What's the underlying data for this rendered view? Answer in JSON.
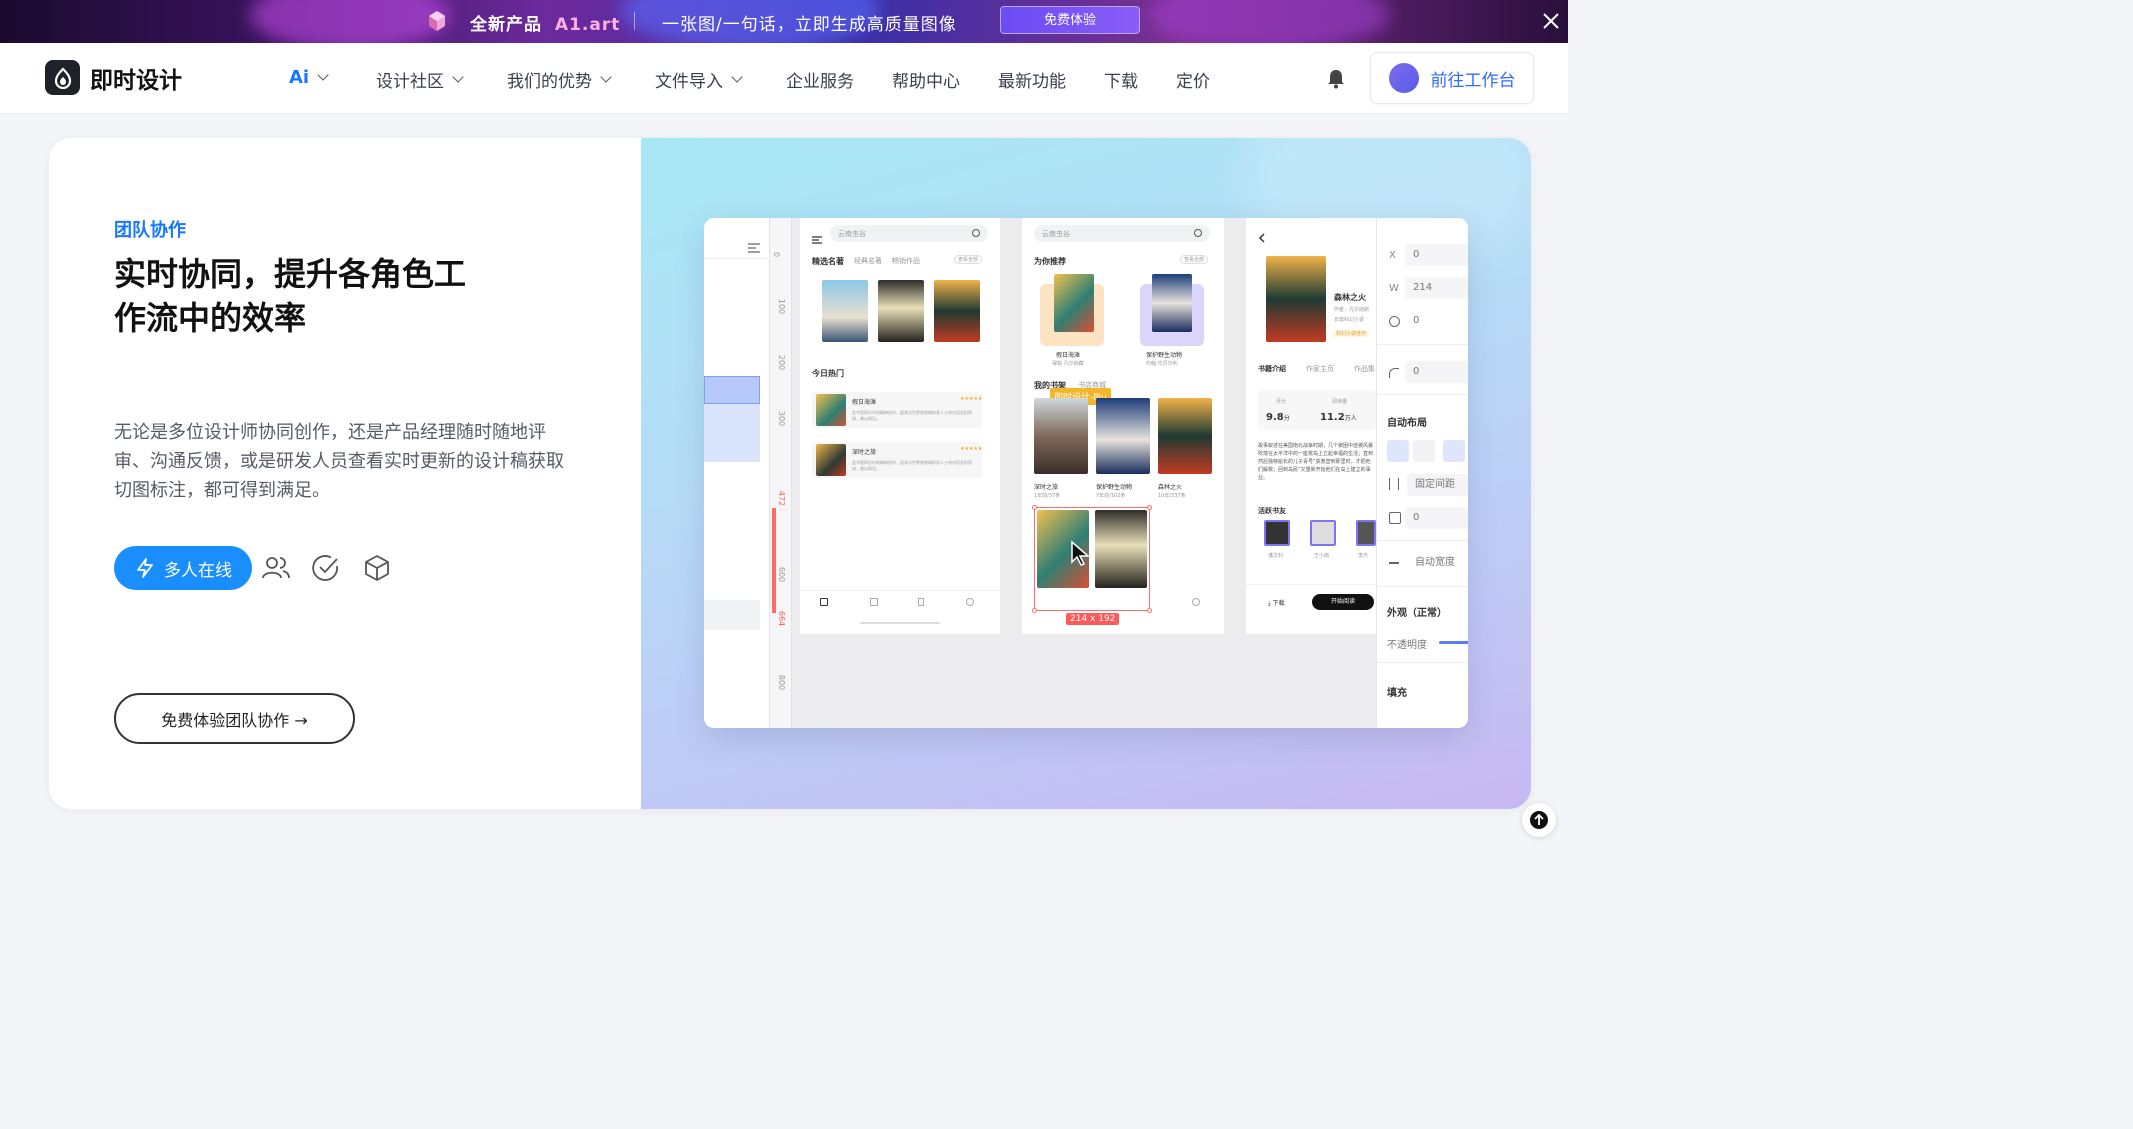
{
  "banner": {
    "product_prefix": "全新产品",
    "product_name": "A1.art",
    "tagline": "一张图/一句话，立即生成高质量图像",
    "cta": "免费体验"
  },
  "nav": {
    "brand": "即时设计",
    "items": [
      {
        "label": "Ai",
        "has_dropdown": true
      },
      {
        "label": "设计社区",
        "has_dropdown": true
      },
      {
        "label": "我们的优势",
        "has_dropdown": true
      },
      {
        "label": "文件导入",
        "has_dropdown": true
      },
      {
        "label": "企业服务",
        "has_dropdown": false
      },
      {
        "label": "帮助中心",
        "has_dropdown": false
      },
      {
        "label": "最新功能",
        "has_dropdown": false
      },
      {
        "label": "下载",
        "has_dropdown": false
      },
      {
        "label": "定价",
        "has_dropdown": false
      }
    ],
    "workspace_button": "前往工作台"
  },
  "hero": {
    "eyebrow": "团队协作",
    "headline_line1": "实时协同，提升各角色工",
    "headline_line2": "作流中的效率",
    "description": "无论是多位设计师协同创作，还是产品经理随时随地评审、沟通反馈，或是研发人员查看实时更新的设计稿获取切图标注，都可得到满足。",
    "active_feature": "多人在线",
    "feature_icons": [
      "users-icon",
      "check-circle-icon",
      "cube-icon"
    ],
    "cta": "免费体验团队协作 →"
  },
  "editor": {
    "ruler_marks": [
      "0",
      "100",
      "200",
      "300",
      "472",
      "600",
      "664",
      "800"
    ],
    "screen1": {
      "search": "云南虫谷",
      "tabs": [
        "精选名著",
        "经典名著",
        "畅销作品"
      ],
      "more": "查看全部",
      "section": "今日热门",
      "list": [
        {
          "title": "假日海滩",
          "stars": "★★★★★",
          "desc": "此书是四分尔的精神创作，虽其与世界各地域的发人士的对话交织而成，难以再见。"
        },
        {
          "title": "深时之旅",
          "stars": "★★★★★",
          "desc": "此书是四分尔的精神创作，虽其与世界各地域的发人士的对话交织而成，难以再见。"
        }
      ]
    },
    "screen2": {
      "search": "云南虫谷",
      "section": "为你推荐",
      "more": "查看全部",
      "recommend": [
        {
          "title": "假日海滩",
          "author": "得勒·凡尔纳藏"
        },
        {
          "title": "保护野生动物",
          "author": "约翰·坎贝尔利"
        }
      ],
      "tabs": [
        "我的书架",
        "书店商城"
      ],
      "collab_tag": "即时设计-Piu",
      "shelf": [
        {
          "title": "深时之旅",
          "meta": "1年前/37条"
        },
        {
          "title": "保护野生动物",
          "meta": "7年前/102条"
        },
        {
          "title": "森林之火",
          "meta": "10年/337条"
        }
      ],
      "selection_size": "214 x 192"
    },
    "screen3": {
      "book_title": "森林之火",
      "author": "作者：凡尔纳斯",
      "subtitle": "长篇科幻小说",
      "badge": "科幻小说佳作",
      "tabs": [
        "书籍介绍",
        "作家主页",
        "作品集"
      ],
      "rating_label": "评分",
      "rating": "9.8",
      "rating_unit": "分",
      "reads_label": "阅读量",
      "reads": "11.2",
      "reads_unit": "万人",
      "intro": "故事叙述在美国南北战争时期，几个被困中途被风暴吹落在太平洋中的一座荒岛上立起幸福的生活；直到然后独特船长的儿子青号”获救登到那里时，才把他们解救；回到岛民”又重新开始他们在岛上建立的事业。",
      "friends_label": "活跃书友",
      "friends": [
        "潘文利",
        "王小雨",
        "李杰"
      ],
      "download": "下载",
      "read": "开始阅读"
    },
    "props": {
      "x": "0",
      "w": "214",
      "rotation": "0",
      "radius": "0",
      "auto_layout": "自动布局",
      "fixed_spacing": "固定间距",
      "padding": "0",
      "auto_width": "自动宽度",
      "appearance": "外观（正常）",
      "opacity": "不透明度",
      "fill": "填充"
    }
  },
  "colors": {
    "accent": "#1677ff",
    "pill": "#1a8dff",
    "selection": "#ff5a5a"
  }
}
